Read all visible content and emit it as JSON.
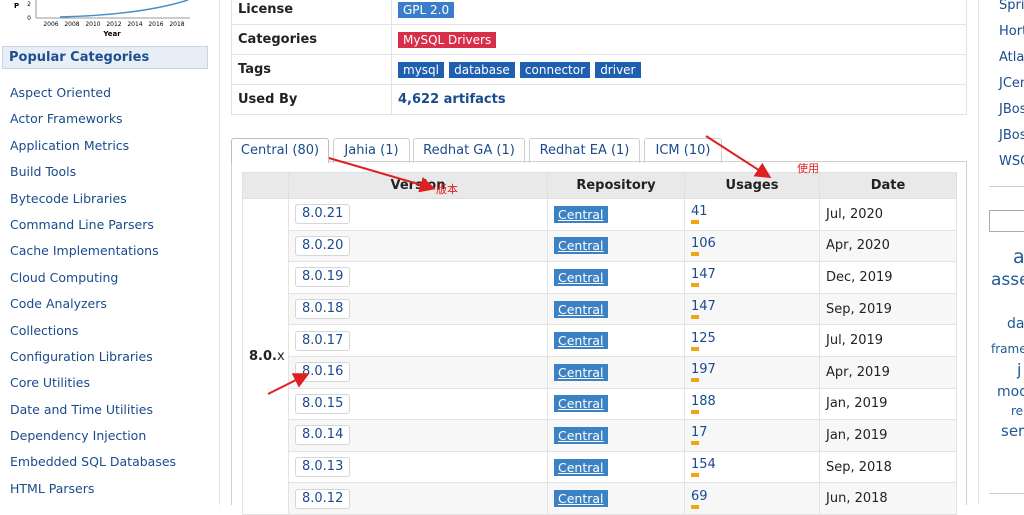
{
  "mini_chart": {
    "y_ticks": [
      "2",
      "0"
    ],
    "x_ticks": [
      "2006",
      "2008",
      "2010",
      "2012",
      "2014",
      "2016",
      "2018"
    ],
    "xlabel": "Year",
    "ylabel_fragment": "P"
  },
  "sidebar": {
    "title": "Popular Categories",
    "categories": [
      "Aspect Oriented",
      "Actor Frameworks",
      "Application Metrics",
      "Build Tools",
      "Bytecode Libraries",
      "Command Line Parsers",
      "Cache Implementations",
      "Cloud Computing",
      "Code Analyzers",
      "Collections",
      "Configuration Libraries",
      "Core Utilities",
      "Date and Time Utilities",
      "Dependency Injection",
      "Embedded SQL Databases",
      "HTML Parsers"
    ]
  },
  "info": {
    "license_label": "License",
    "license_value": "GPL 2.0",
    "categories_label": "Categories",
    "categories_value": "MySQL Drivers",
    "tags_label": "Tags",
    "tags": [
      "mysql",
      "database",
      "connector",
      "driver"
    ],
    "used_by_label": "Used By",
    "used_by_value": "4,622 artifacts"
  },
  "tabs": [
    "Central (80)",
    "Jahia (1)",
    "Redhat GA (1)",
    "Redhat EA (1)",
    "ICM (10)"
  ],
  "versions": {
    "headers": {
      "version": "Version",
      "repository": "Repository",
      "usages": "Usages",
      "date": "Date"
    },
    "group_label_main": "8.0.",
    "group_label_suffix": "x",
    "rows": [
      {
        "version": "8.0.21",
        "repo": "Central",
        "usages": "41",
        "date": "Jul, 2020"
      },
      {
        "version": "8.0.20",
        "repo": "Central",
        "usages": "106",
        "date": "Apr, 2020"
      },
      {
        "version": "8.0.19",
        "repo": "Central",
        "usages": "147",
        "date": "Dec, 2019"
      },
      {
        "version": "8.0.18",
        "repo": "Central",
        "usages": "147",
        "date": "Sep, 2019"
      },
      {
        "version": "8.0.17",
        "repo": "Central",
        "usages": "125",
        "date": "Jul, 2019"
      },
      {
        "version": "8.0.16",
        "repo": "Central",
        "usages": "197",
        "date": "Apr, 2019"
      },
      {
        "version": "8.0.15",
        "repo": "Central",
        "usages": "188",
        "date": "Jan, 2019"
      },
      {
        "version": "8.0.14",
        "repo": "Central",
        "usages": "17",
        "date": "Jan, 2019"
      },
      {
        "version": "8.0.13",
        "repo": "Central",
        "usages": "154",
        "date": "Sep, 2018"
      },
      {
        "version": "8.0.12",
        "repo": "Central",
        "usages": "69",
        "date": "Jun, 2018"
      }
    ]
  },
  "right_sidebar": {
    "links": [
      "Spri",
      "Hort",
      "Atla",
      "JCen",
      "JBos",
      "JBos",
      "WSO"
    ],
    "ad_lines": [
      "a",
      "asse",
      "da",
      "frame",
      "j",
      "mod",
      "re",
      "ser"
    ]
  },
  "annotations": {
    "version_note": "版本",
    "usages_note": "使用",
    "color": "#e02020"
  },
  "colors": {
    "link": "#1a4b8c",
    "category_badge": "#d72f4a",
    "tag_badge": "#1f5fb0",
    "license_badge": "#3a7dc9",
    "repo_badge": "#3b82c4",
    "usage_bar": "#f0a512"
  }
}
